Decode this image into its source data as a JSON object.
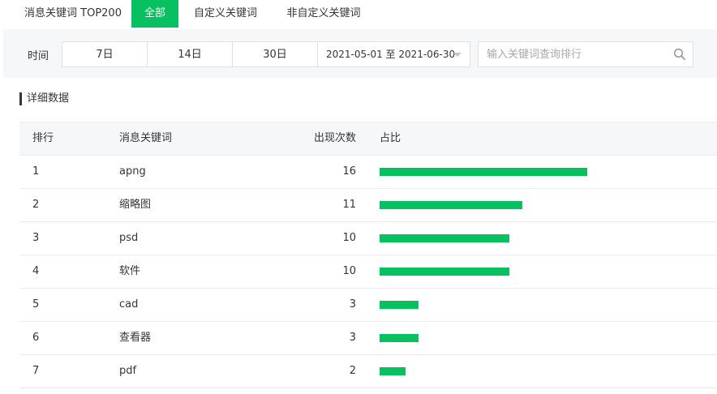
{
  "tabs": [
    {
      "label": "消息关键词 TOP200",
      "active": false
    },
    {
      "label": "全部",
      "active": true
    },
    {
      "label": "自定义关键词",
      "active": false
    },
    {
      "label": "非自定义关键词",
      "active": false
    }
  ],
  "filter": {
    "label": "时间",
    "ranges": [
      "7日",
      "14日",
      "30日"
    ],
    "date_range": "2021-05-01 至 2021-06-30",
    "search_placeholder": "输入关键词查询排行",
    "search_value": ""
  },
  "section_title": "详细数据",
  "table": {
    "headers": {
      "rank": "排行",
      "keyword": "消息关键词",
      "count": "出现次数",
      "share": "占比"
    },
    "rows": [
      {
        "rank": "1",
        "keyword": "apng",
        "count": "16",
        "share": 1.0
      },
      {
        "rank": "2",
        "keyword": "缩略图",
        "count": "11",
        "share": 0.6875
      },
      {
        "rank": "3",
        "keyword": "psd",
        "count": "10",
        "share": 0.625
      },
      {
        "rank": "4",
        "keyword": "软件",
        "count": "10",
        "share": 0.625
      },
      {
        "rank": "5",
        "keyword": "cad",
        "count": "3",
        "share": 0.1875
      },
      {
        "rank": "6",
        "keyword": "查看器",
        "count": "3",
        "share": 0.1875
      },
      {
        "rank": "7",
        "keyword": "pdf",
        "count": "2",
        "share": 0.125
      }
    ]
  },
  "colors": {
    "accent": "#07c160",
    "header_bg": "#f6f7f9",
    "text": "#353535"
  }
}
